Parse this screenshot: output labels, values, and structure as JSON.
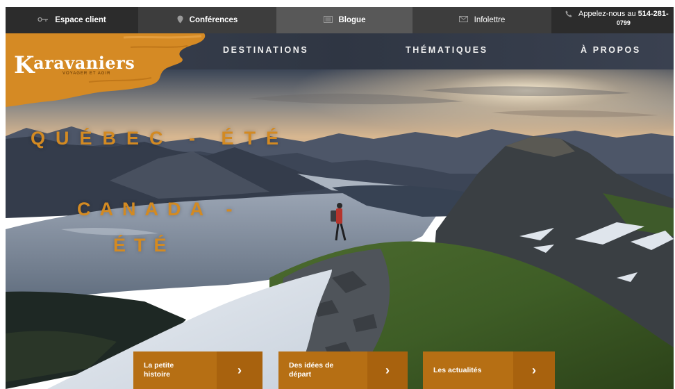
{
  "topbar": {
    "espace": {
      "label": "Espace client",
      "icon": "key-icon"
    },
    "conferences": {
      "label": "Conférences",
      "icon": "map-pin-icon"
    },
    "blogue": {
      "label": "Blogue",
      "icon": "newspaper-icon"
    },
    "infolettre": {
      "label": "Infolettre",
      "icon": "envelope-icon"
    },
    "call": {
      "prefix": "Appelez-nous au",
      "number_part1": "514-281-",
      "number_part2": "0799",
      "icon": "phone-icon"
    }
  },
  "logo": {
    "initial": "K",
    "name": "aravaniers",
    "tagline": "VOYAGER ET AGIR"
  },
  "nav": {
    "destinations": "DESTINATIONS",
    "thematiques": "THÉMATIQUES",
    "apropos": "À PROPOS"
  },
  "hero": {
    "line1": "QUÉBEC - ÉTÉ",
    "line2": "CANADA -",
    "line3": "ÉTÉ"
  },
  "cards": [
    {
      "line1": "La petite",
      "line2": "histoire",
      "arrow": "›"
    },
    {
      "line1": "Des idées de",
      "line2": "départ",
      "arrow": "›"
    },
    {
      "line1": "Les actualités",
      "line2": "",
      "arrow": "›"
    }
  ],
  "colors": {
    "accent": "#d38a22",
    "card": "#b66f14",
    "nav": "#333a46"
  }
}
